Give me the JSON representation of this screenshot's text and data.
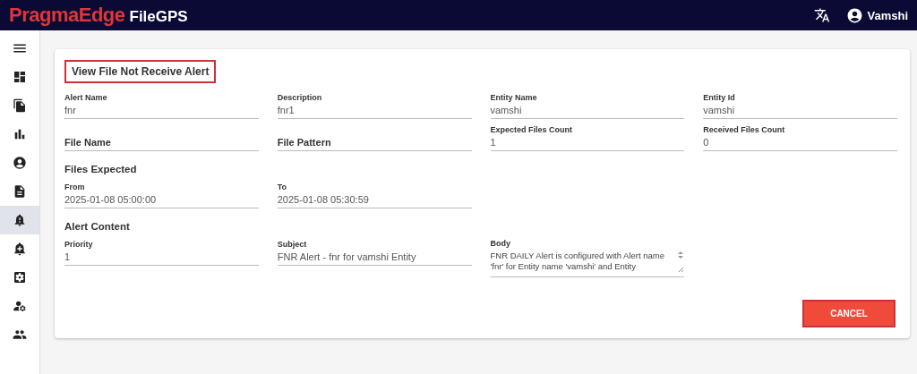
{
  "header": {
    "brand": "PragmaEdge",
    "product": "FileGPS",
    "user": "Vamshi"
  },
  "sidebar": {
    "items": [
      {
        "selected": false
      },
      {
        "selected": false
      },
      {
        "selected": false
      },
      {
        "selected": false
      },
      {
        "selected": false
      },
      {
        "selected": true
      },
      {
        "selected": false
      },
      {
        "selected": false
      },
      {
        "selected": false
      },
      {
        "selected": false
      }
    ]
  },
  "form": {
    "title": "View File Not Receive Alert",
    "rows": [
      {
        "kind": "fields",
        "fields": [
          {
            "label": "Alert Name",
            "value": "fnr"
          },
          {
            "label": "Description",
            "value": "fnr1"
          },
          {
            "label": "Entity Name",
            "value": "vamshi"
          },
          {
            "label": "Entity Id",
            "value": "vamshi"
          }
        ]
      },
      {
        "kind": "fields",
        "fields": [
          {
            "placeholder": "File Name"
          },
          {
            "placeholder": "File Pattern"
          },
          {
            "label": "Expected Files Count",
            "value": "1"
          },
          {
            "label": "Received Files Count",
            "value": "0"
          }
        ]
      },
      {
        "kind": "heading",
        "text": "Files Expected"
      },
      {
        "kind": "fields",
        "fields": [
          {
            "label": "From",
            "value": "2025-01-08 05:00:00"
          },
          {
            "label": "To",
            "value": "2025-01-08 05:30:59"
          }
        ]
      },
      {
        "kind": "heading",
        "text": "Alert Content"
      },
      {
        "kind": "fields",
        "fields": [
          {
            "label": "Priority",
            "value": "1"
          },
          {
            "label": "Subject",
            "value": "FNR Alert - fnr for vamshi Entity"
          },
          {
            "label": "Body",
            "value": "FNR DAILY Alert is configured with Alert name 'fnr' for Entity name 'vamshi' and Entity",
            "kind": "textarea"
          }
        ]
      }
    ],
    "buttons": [
      "CANCEL"
    ]
  }
}
